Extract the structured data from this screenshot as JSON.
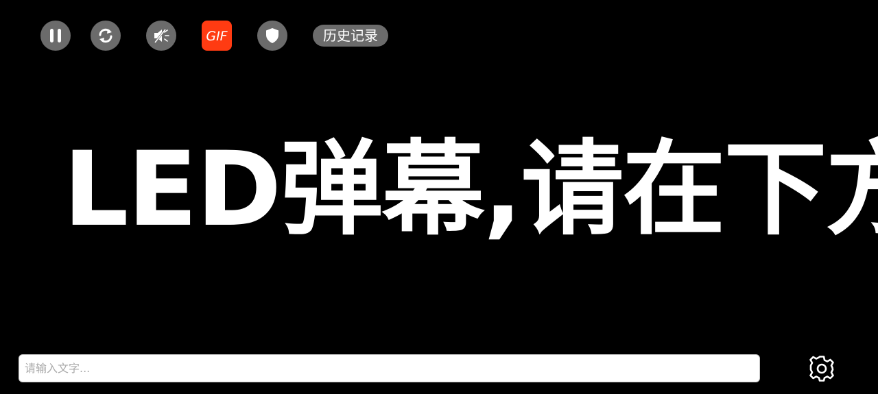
{
  "toolbar": {
    "buttons": [
      {
        "name": "pause",
        "icon": "pause-icon"
      },
      {
        "name": "reload",
        "icon": "refresh-icon"
      },
      {
        "name": "mute",
        "icon": "speaker-muted-icon"
      },
      {
        "name": "gif",
        "icon": "gif-icon",
        "label": "GIF"
      },
      {
        "name": "shield",
        "icon": "shield-icon"
      }
    ],
    "history_label": "历史记录"
  },
  "marquee": {
    "text": "LED弹幕,请在下方输入文字"
  },
  "input": {
    "placeholder": "请输入文字...",
    "value": ""
  },
  "settings": {
    "icon": "gear-icon"
  },
  "colors": {
    "background": "#000000",
    "button_gray": "#6b6b6b",
    "gif_accent": "#ff3b12",
    "text": "#ffffff"
  }
}
